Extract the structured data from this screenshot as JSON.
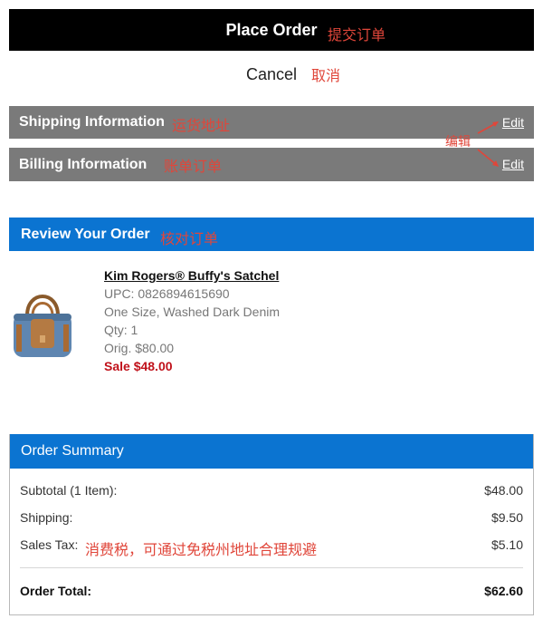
{
  "header": {
    "place_order_label": "Place Order",
    "place_order_note": "提交订单"
  },
  "cancel": {
    "label": "Cancel",
    "note": "取消"
  },
  "shipping": {
    "title": "Shipping Information",
    "note": "运货地址",
    "edit_label": "Edit"
  },
  "billing": {
    "title": "Billing Information",
    "note": "账单订单",
    "edit_label": "Edit"
  },
  "edit_note": "编辑",
  "review": {
    "title": "Review Your Order",
    "note": "核对订单"
  },
  "item": {
    "name": "Kim Rogers® Buffy's Satchel",
    "upc": "UPC: 0826894615690",
    "variant": "One Size, Washed Dark Denim",
    "qty": "Qty: 1",
    "orig": "Orig. $80.00",
    "sale": "Sale $48.00"
  },
  "summary": {
    "title": "Order Summary",
    "subtotal_label": "Subtotal (1 Item):",
    "subtotal_value": "$48.00",
    "shipping_label": "Shipping:",
    "shipping_value": "$9.50",
    "tax_label": "Sales Tax:",
    "tax_value": "$5.10",
    "tax_note": "消费税，可通过免税州地址合理规避",
    "total_label": "Order Total:",
    "total_value": "$62.60"
  },
  "colors": {
    "black_bar": "#000000",
    "gray_bar": "#7a7a7a",
    "blue_bar": "#0b74d1",
    "sale_red": "#c0111a",
    "annotation_red": "#e0463a"
  }
}
